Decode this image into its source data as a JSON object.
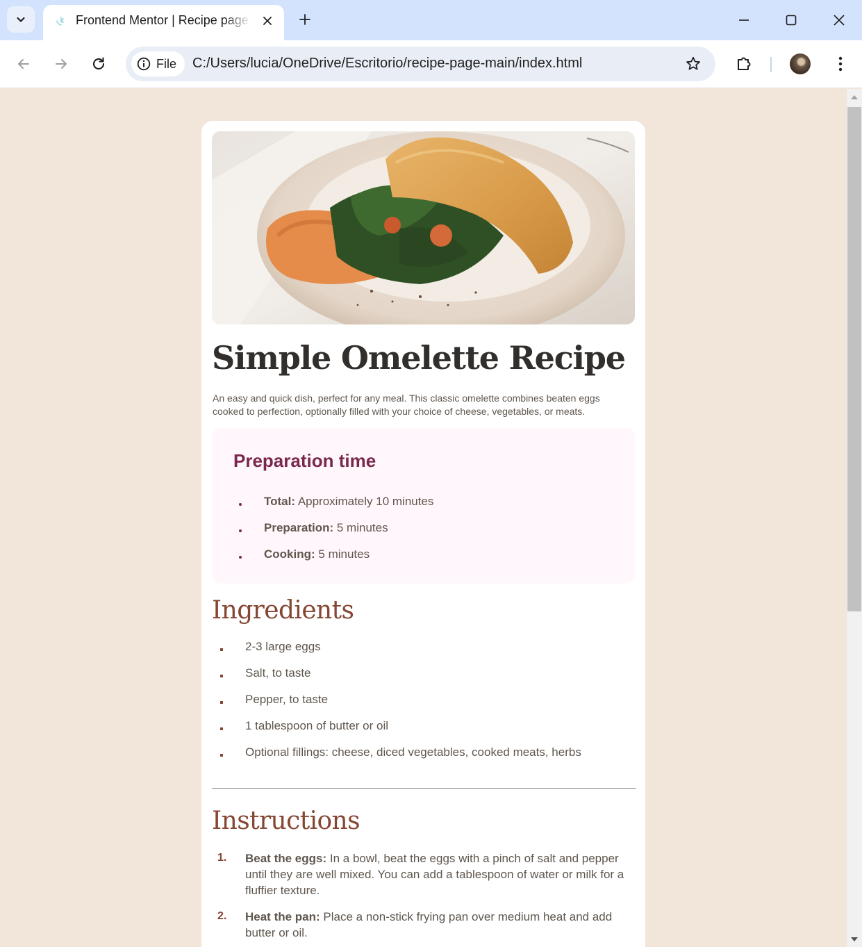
{
  "browser": {
    "tab_title": "Frontend Mentor | Recipe page",
    "site_chip_label": "File",
    "url": "C:/Users/lucia/OneDrive/Escritorio/recipe-page-main/index.html"
  },
  "recipe": {
    "image_alt": "omelette on a plate",
    "title": "Simple Omelette Recipe",
    "intro": "An easy and quick dish, perfect for any meal. This classic omelette combines beaten eggs cooked to perfection, optionally filled with your choice of cheese, vegetables, or meats.",
    "preparation": {
      "title": "Preparation time",
      "items": [
        {
          "label": "Total:",
          "value": "Approximately 10 minutes"
        },
        {
          "label": "Preparation:",
          "value": "5 minutes"
        },
        {
          "label": "Cooking:",
          "value": "5 minutes"
        }
      ]
    },
    "ingredients": {
      "title": "Ingredients",
      "items": [
        "2-3 large eggs",
        "Salt, to taste",
        "Pepper, to taste",
        "1 tablespoon of butter or oil",
        "Optional fillings: cheese, diced vegetables, cooked meats, herbs"
      ]
    },
    "instructions": {
      "title": "Instructions",
      "items": [
        {
          "num": "1.",
          "label": "Beat the eggs:",
          "text": "In a bowl, beat the eggs with a pinch of salt and pepper until they are well mixed. You can add a tablespoon of water or milk for a fluffier texture."
        },
        {
          "num": "2.",
          "label": "Heat the pan:",
          "text": "Place a non-stick frying pan over medium heat and add butter or oil."
        }
      ]
    }
  },
  "colors": {
    "page_bg": "#f2e5da",
    "accent_rose": "#7a284e",
    "accent_brown": "#854632",
    "chrome_tabbar": "#d3e3fd"
  },
  "icons": {
    "tab_menu": "chevron-down-icon",
    "close_tab": "close-icon",
    "new_tab": "plus-icon",
    "minimize": "minimize-icon",
    "maximize": "maximize-icon",
    "close_window": "close-icon",
    "back": "arrow-left-icon",
    "forward": "arrow-right-icon",
    "reload": "reload-icon",
    "site_info": "info-icon",
    "bookmark": "star-icon",
    "extensions": "puzzle-icon",
    "menu": "kebab-menu-icon"
  }
}
